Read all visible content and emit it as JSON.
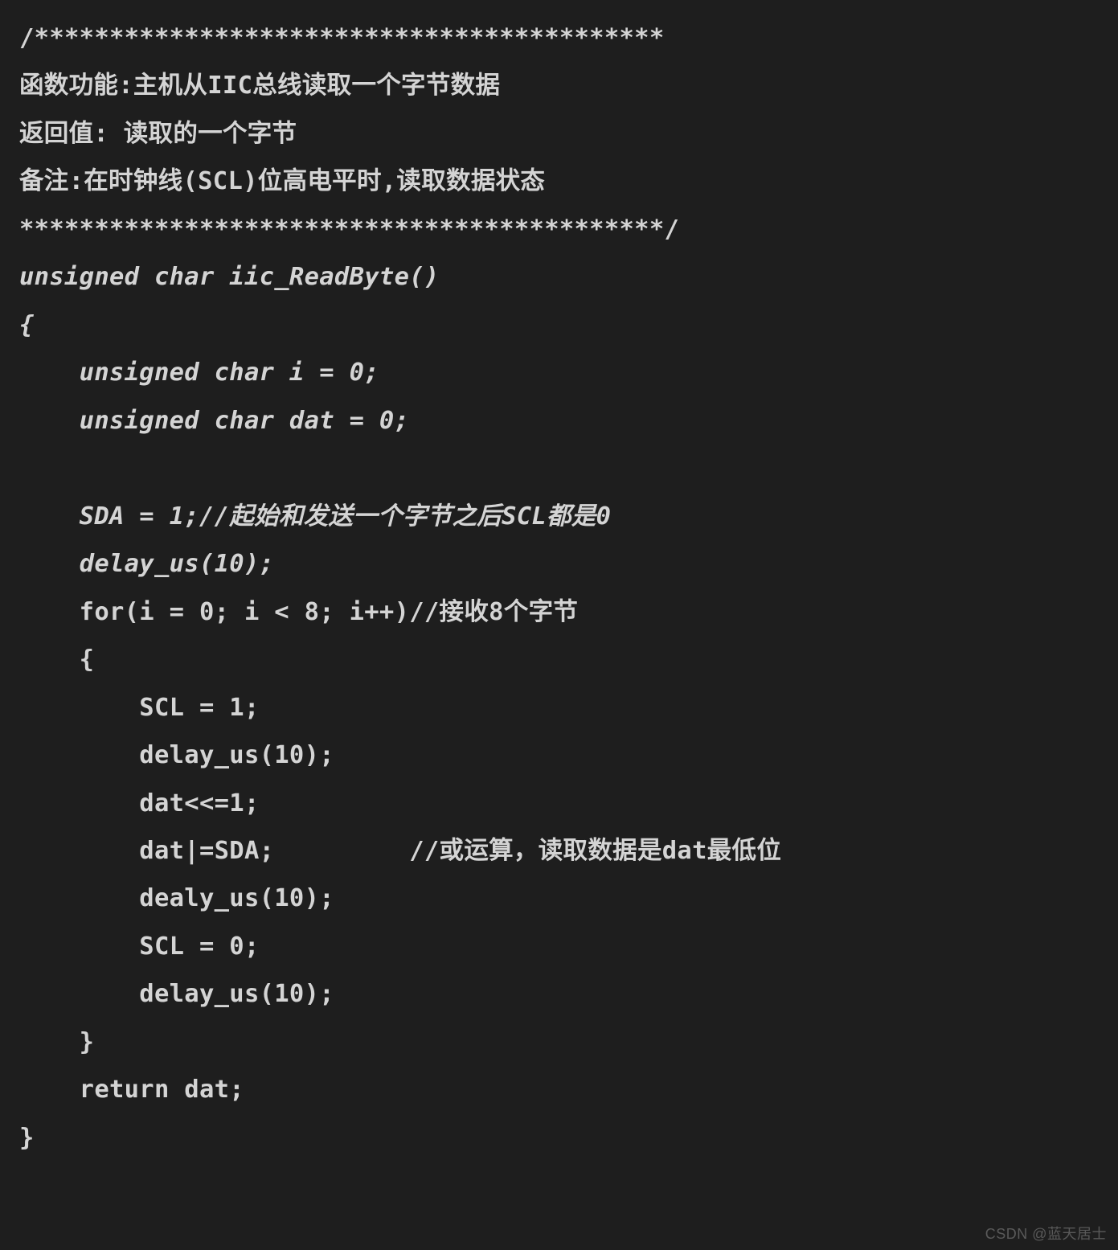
{
  "code_lines": [
    {
      "text": "/******************************************",
      "classes": "bold"
    },
    {
      "text": "函数功能:主机从IIC总线读取一个字节数据",
      "classes": "bold"
    },
    {
      "text": "返回值: 读取的一个字节",
      "classes": "bold"
    },
    {
      "text": "备注:在时钟线(SCL)位高电平时,读取数据状态",
      "classes": "bold"
    },
    {
      "text": "*******************************************/",
      "classes": "bold"
    },
    {
      "text": "unsigned char iic_ReadByte()",
      "classes": "bold italic"
    },
    {
      "text": "{",
      "classes": "bold italic"
    },
    {
      "text": "    unsigned char i = 0;",
      "classes": "bold italic"
    },
    {
      "text": "    unsigned char dat = 0;",
      "classes": "bold italic"
    },
    {
      "text": "",
      "classes": ""
    },
    {
      "text": "    SDA = 1;//起始和发送一个字节之后SCL都是0",
      "classes": "bold italic"
    },
    {
      "text": "    delay_us(10);",
      "classes": "bold italic"
    },
    {
      "text": "    for(i = 0; i < 8; i++)//接收8个字节",
      "classes": "bold"
    },
    {
      "text": "    {",
      "classes": "bold"
    },
    {
      "text": "        SCL = 1;",
      "classes": "bold"
    },
    {
      "text": "        delay_us(10);",
      "classes": "bold"
    },
    {
      "text": "        dat<<=1;",
      "classes": "bold"
    },
    {
      "text": "        dat|=SDA;         //或运算，读取数据是dat最低位",
      "classes": "bold"
    },
    {
      "text": "        dealy_us(10);",
      "classes": "bold"
    },
    {
      "text": "        SCL = 0;",
      "classes": "bold"
    },
    {
      "text": "        delay_us(10);",
      "classes": "bold"
    },
    {
      "text": "    }",
      "classes": "bold"
    },
    {
      "text": "    return dat;",
      "classes": "bold"
    },
    {
      "text": "}",
      "classes": "bold"
    }
  ],
  "watermark": "CSDN @蓝天居士"
}
